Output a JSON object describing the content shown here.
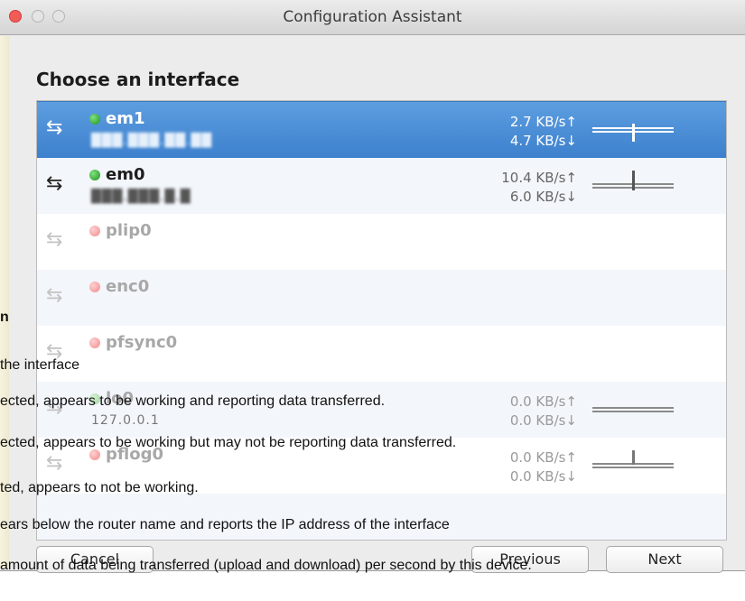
{
  "window": {
    "title": "Configuration Assistant",
    "heading": "Choose an interface"
  },
  "interfaces": [
    {
      "name": "em1",
      "status": "green",
      "ip": "███.███.██.██",
      "up": "2.7 KB/s↑",
      "down": "4.7 KB/s↓",
      "selected": true
    },
    {
      "name": "em0",
      "status": "green",
      "ip": "███.███.█.█",
      "up": "10.4 KB/s↑",
      "down": "6.0 KB/s↓",
      "selected": false
    },
    {
      "name": "plip0",
      "status": "red",
      "ip": "",
      "up": "",
      "down": ""
    },
    {
      "name": "enc0",
      "status": "red",
      "ip": "",
      "up": "",
      "down": ""
    },
    {
      "name": "pfsync0",
      "status": "red",
      "ip": "",
      "up": "",
      "down": ""
    },
    {
      "name": "lo0",
      "status": "pale-green",
      "ip": "127.0.0.1",
      "up": "0.0 KB/s↑",
      "down": "0.0 KB/s↓"
    },
    {
      "name": "pflog0",
      "status": "red",
      "ip": "",
      "up": "0.0 KB/s↑",
      "down": "0.0 KB/s↓"
    }
  ],
  "buttons": {
    "cancel": "Cancel",
    "previous": "Previous",
    "next": "Next"
  },
  "overlay_text": {
    "line0": "n",
    "line1": "the interface",
    "line2": "ected, appears to be working and reporting data transferred.",
    "line3": "ected, appears to be working but may not be reporting data transferred.",
    "line4": "ted, appears to not be working.",
    "line5": "ears below the router name and reports the IP address of the interface",
    "line6": "amount of data being transferred (upload and download) per second by this device."
  }
}
